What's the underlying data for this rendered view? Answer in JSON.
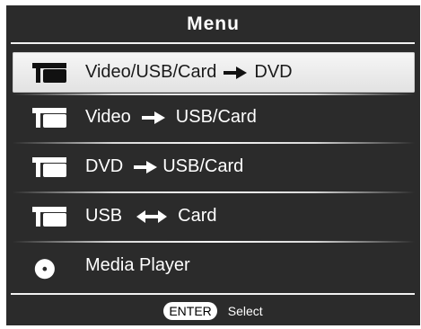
{
  "menu": {
    "title": "Menu",
    "items": [
      {
        "icon": "tv-stand-icon",
        "left": "Video/USB/Card",
        "arrow": "right-arrow-icon",
        "right": "DVD",
        "selected": true
      },
      {
        "icon": "tv-stand-icon",
        "left": "Video",
        "arrow": "right-arrow-icon",
        "right": "USB/Card",
        "selected": false
      },
      {
        "icon": "tv-stand-icon",
        "left": "DVD",
        "arrow": "right-arrow-icon",
        "right": "USB/Card",
        "selected": false
      },
      {
        "icon": "tv-stand-icon",
        "left": "USB",
        "arrow": "double-arrow-icon",
        "right": "Card",
        "selected": false
      },
      {
        "icon": "disc-icon",
        "label": "Media Player",
        "selected": false
      }
    ]
  },
  "footer": {
    "key": "ENTER",
    "action": "Select"
  },
  "colors": {
    "panel_bg": "#2b2b2b",
    "text": "#ffffff",
    "selected_bg": "#f0f0f0",
    "selected_text": "#1a1a1a"
  }
}
